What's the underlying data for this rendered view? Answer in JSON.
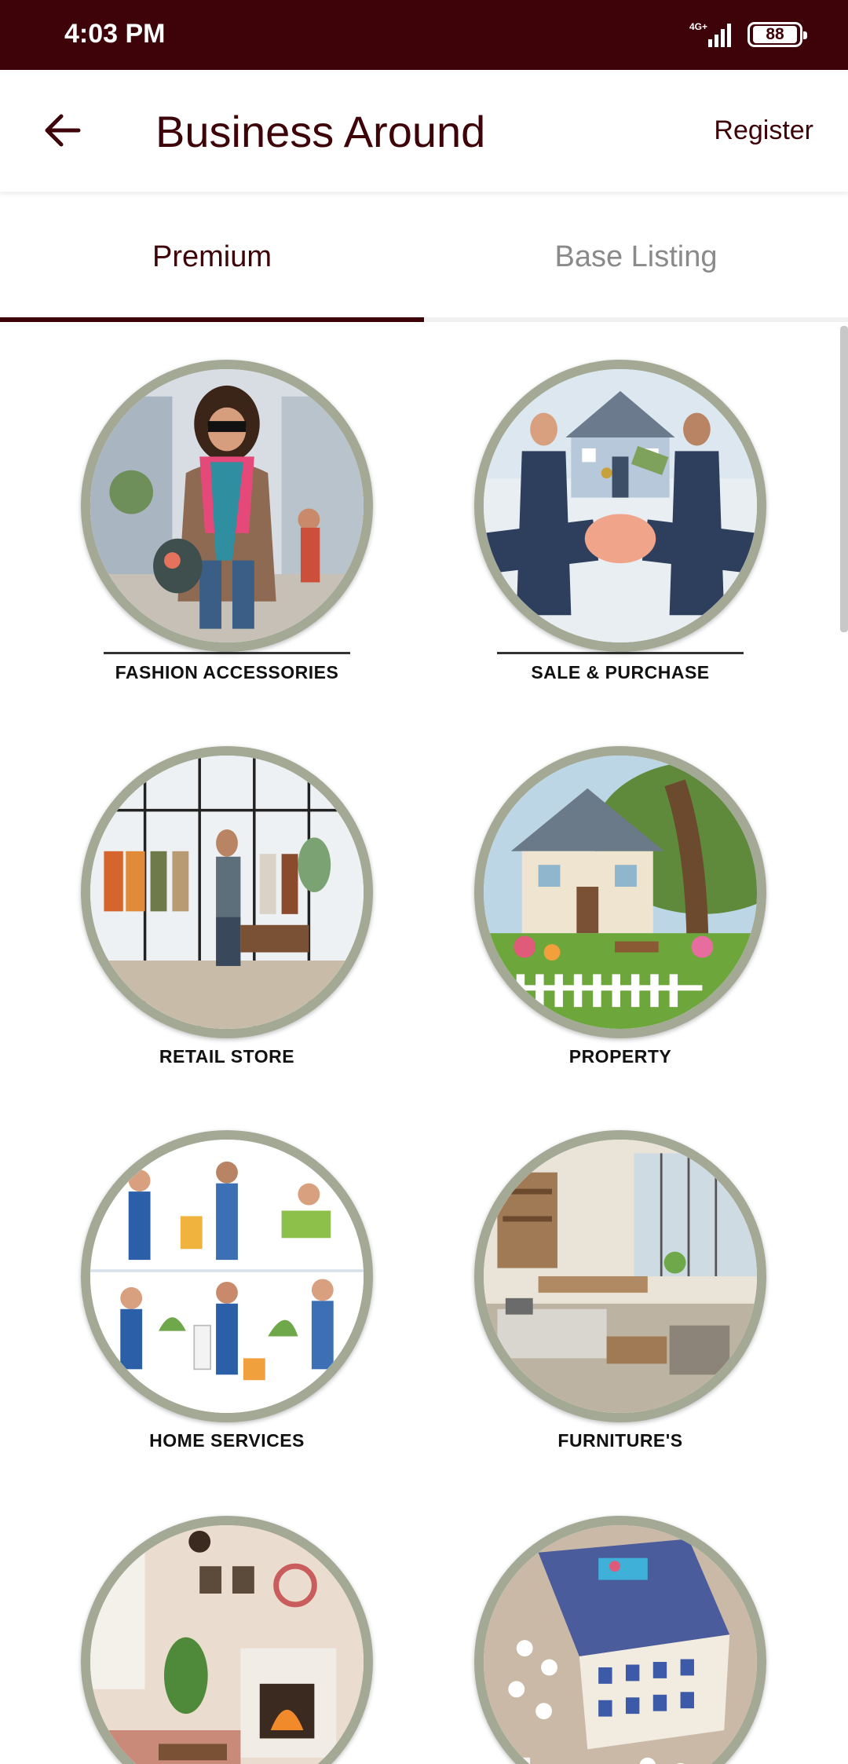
{
  "status_bar": {
    "time": "4:03 PM",
    "network": "4G+",
    "battery": "88"
  },
  "app_bar": {
    "title": "Business Around",
    "register_label": "Register",
    "back_icon": "arrow-left-icon"
  },
  "tabs": [
    {
      "label": "Premium",
      "active": true
    },
    {
      "label": "Base Listing",
      "active": false
    }
  ],
  "categories": [
    {
      "label": "FASHION ACCESSORIES",
      "image": "fashion-woman-illustration"
    },
    {
      "label": "SALE & PURCHASE",
      "image": "handshake-house-illustration"
    },
    {
      "label": "RETAIL STORE",
      "image": "clothing-store-illustration"
    },
    {
      "label": "PROPERTY",
      "image": "house-garden-illustration"
    },
    {
      "label": "HOME SERVICES",
      "image": "cleaning-workers-illustration"
    },
    {
      "label": "FURNITURE'S",
      "image": "furniture-showroom-illustration"
    },
    {
      "label": "",
      "image": "living-room-fireplace-illustration"
    },
    {
      "label": "",
      "image": "hotel-building-illustration"
    }
  ],
  "colors": {
    "primary": "#3d0309",
    "circle_border": "#a3a995",
    "inactive_tab": "#8a8a8a"
  }
}
